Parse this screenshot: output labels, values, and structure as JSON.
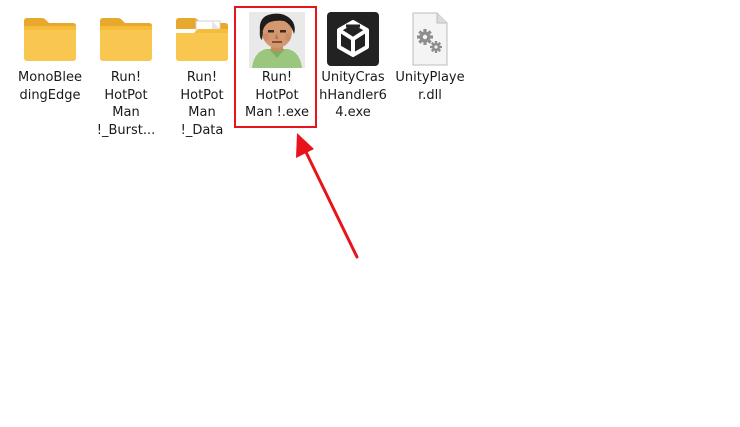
{
  "files": [
    {
      "label": "MonoBlee\ndingEdge",
      "icon": "folder-icon"
    },
    {
      "label": "Run!\nHotPot\nMan\n!_Burst...",
      "icon": "folder-icon"
    },
    {
      "label": "Run!\nHotPot\nMan\n!_Data",
      "icon": "folder-with-document-icon"
    },
    {
      "label": "Run!\nHotPot\nMan !.exe",
      "icon": "man-portrait-app-icon"
    },
    {
      "label": "UnityCras\nhHandler6\n4.exe",
      "icon": "unity-cube-icon"
    },
    {
      "label": "UnityPlaye\nr.dll",
      "icon": "dll-gear-file-icon"
    }
  ],
  "annotation": {
    "box_color": "#e8141b",
    "arrow_color": "#e8141b"
  }
}
